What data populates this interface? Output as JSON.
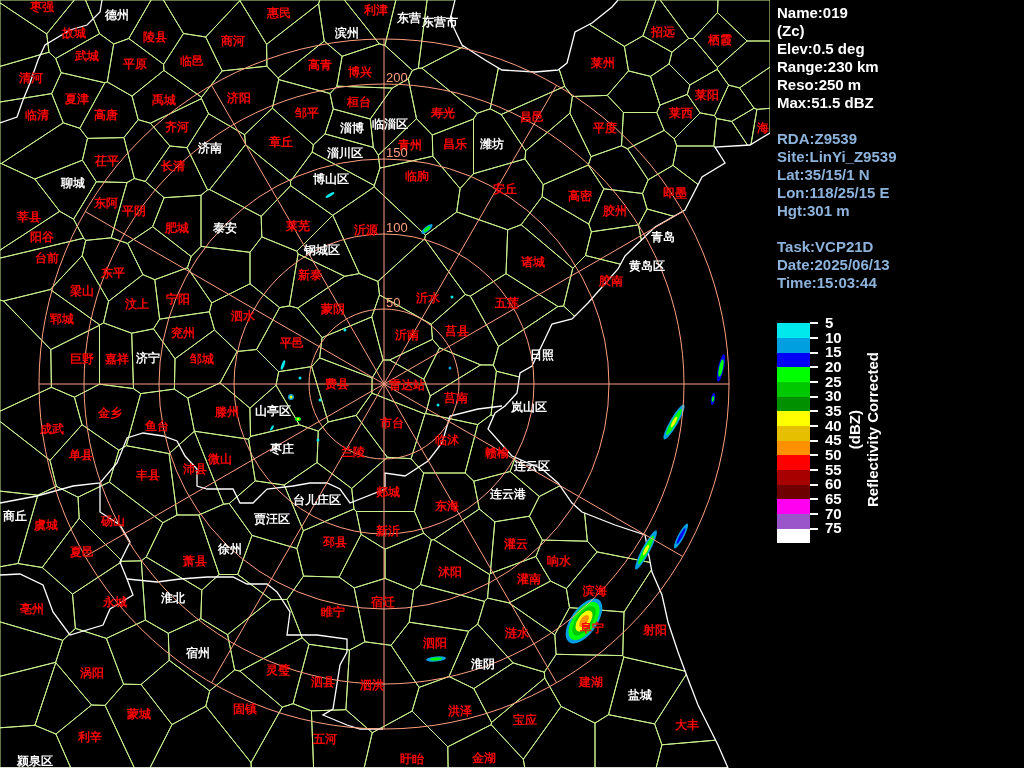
{
  "radar_map": {
    "range_rings": [
      {
        "label": "200"
      },
      {
        "label": "150"
      },
      {
        "label": "100"
      },
      {
        "label": "50"
      }
    ],
    "places": [
      {
        "name": "枣强",
        "color": "#ff0000"
      },
      {
        "name": "德州",
        "color": "#ffffff"
      },
      {
        "name": "惠民",
        "color": "#ff0000"
      },
      {
        "name": "利津",
        "color": "#ff0000"
      },
      {
        "name": "东营",
        "color": "#ffffff"
      },
      {
        "name": "东营市",
        "color": "#ffffff"
      },
      {
        "name": "故城",
        "color": "#ff0000"
      },
      {
        "name": "陵县",
        "color": "#ff0000"
      },
      {
        "name": "商河",
        "color": "#ff0000"
      },
      {
        "name": "滨州",
        "color": "#ffffff"
      },
      {
        "name": "招远",
        "color": "#ff0000"
      },
      {
        "name": "栖霞",
        "color": "#ff0000"
      },
      {
        "name": "武城",
        "color": "#ff0000"
      },
      {
        "name": "平原",
        "color": "#ff0000"
      },
      {
        "name": "临邑",
        "color": "#ff0000"
      },
      {
        "name": "高青",
        "color": "#ff0000"
      },
      {
        "name": "博兴",
        "color": "#ff0000"
      },
      {
        "name": "莱州",
        "color": "#ff0000"
      },
      {
        "name": "清河",
        "color": "#ff0000"
      },
      {
        "name": "夏津",
        "color": "#ff0000"
      },
      {
        "name": "禹城",
        "color": "#ff0000"
      },
      {
        "name": "济阳",
        "color": "#ff0000"
      },
      {
        "name": "桓台",
        "color": "#ff0000"
      },
      {
        "name": "莱阳",
        "color": "#ff0000"
      },
      {
        "name": "临清",
        "color": "#ff0000"
      },
      {
        "name": "高唐",
        "color": "#ff0000"
      },
      {
        "name": "齐河",
        "color": "#ff0000"
      },
      {
        "name": "邹平",
        "color": "#ff0000"
      },
      {
        "name": "淄博",
        "color": "#ffffff"
      },
      {
        "name": "临淄区",
        "color": "#ffffff"
      },
      {
        "name": "寿光",
        "color": "#ff0000"
      },
      {
        "name": "昌邑",
        "color": "#ff0000"
      },
      {
        "name": "平度",
        "color": "#ff0000"
      },
      {
        "name": "莱西",
        "color": "#ff0000"
      },
      {
        "name": "海",
        "color": "#ff0000"
      },
      {
        "name": "济南",
        "color": "#ffffff"
      },
      {
        "name": "章丘",
        "color": "#ff0000"
      },
      {
        "name": "淄川区",
        "color": "#ffffff"
      },
      {
        "name": "青州",
        "color": "#ff0000"
      },
      {
        "name": "昌乐",
        "color": "#ff0000"
      },
      {
        "name": "潍坊",
        "color": "#ffffff"
      },
      {
        "name": "聊城",
        "color": "#ffffff"
      },
      {
        "name": "茌平",
        "color": "#ff0000"
      },
      {
        "name": "长清",
        "color": "#ff0000"
      },
      {
        "name": "博山区",
        "color": "#ffffff"
      },
      {
        "name": "临朐",
        "color": "#ff0000"
      },
      {
        "name": "安丘",
        "color": "#ff0000"
      },
      {
        "name": "高密",
        "color": "#ff0000"
      },
      {
        "name": "即墨",
        "color": "#ff0000"
      },
      {
        "name": "莘县",
        "color": "#ff0000"
      },
      {
        "name": "东阿",
        "color": "#ff0000"
      },
      {
        "name": "平阴",
        "color": "#ff0000"
      },
      {
        "name": "胶州",
        "color": "#ff0000"
      },
      {
        "name": "阳谷",
        "color": "#ff0000"
      },
      {
        "name": "肥城",
        "color": "#ff0000"
      },
      {
        "name": "泰安",
        "color": "#ffffff"
      },
      {
        "name": "莱芜",
        "color": "#ff0000"
      },
      {
        "name": "沂源",
        "color": "#ff0000"
      },
      {
        "name": "青岛",
        "color": "#ffffff"
      },
      {
        "name": "台前",
        "color": "#ff0000"
      },
      {
        "name": "东平",
        "color": "#ff0000"
      },
      {
        "name": "新泰",
        "color": "#ff0000"
      },
      {
        "name": "钢城区",
        "color": "#ffffff"
      },
      {
        "name": "诸城",
        "color": "#ff0000"
      },
      {
        "name": "胶南",
        "color": "#ff0000"
      },
      {
        "name": "黄岛区",
        "color": "#ffffff"
      },
      {
        "name": "郓城",
        "color": "#ff0000"
      },
      {
        "name": "梁山",
        "color": "#ff0000"
      },
      {
        "name": "汶上",
        "color": "#ff0000"
      },
      {
        "name": "宁阳",
        "color": "#ff0000"
      },
      {
        "name": "泗水",
        "color": "#ff0000"
      },
      {
        "name": "蒙阴",
        "color": "#ff0000"
      },
      {
        "name": "沂水",
        "color": "#ff0000"
      },
      {
        "name": "五莲",
        "color": "#ff0000"
      },
      {
        "name": "兖州",
        "color": "#ff0000"
      },
      {
        "name": "平邑",
        "color": "#ff0000"
      },
      {
        "name": "沂南",
        "color": "#ff0000"
      },
      {
        "name": "莒县",
        "color": "#ff0000"
      },
      {
        "name": "巨野",
        "color": "#ff0000"
      },
      {
        "name": "嘉祥",
        "color": "#ff0000"
      },
      {
        "name": "济宁",
        "color": "#ffffff"
      },
      {
        "name": "邹城",
        "color": "#ff0000"
      },
      {
        "name": "日照",
        "color": "#ffffff"
      },
      {
        "name": "费县",
        "color": "#ff0000"
      },
      {
        "name": "雷达站",
        "color": "#ff0000"
      },
      {
        "name": "金乡",
        "color": "#ff0000"
      },
      {
        "name": "滕州",
        "color": "#ff0000"
      },
      {
        "name": "山亭区",
        "color": "#ffffff"
      },
      {
        "name": "莒南",
        "color": "#ff0000"
      },
      {
        "name": "岚山区",
        "color": "#ffffff"
      },
      {
        "name": "成武",
        "color": "#ff0000"
      },
      {
        "name": "鱼台",
        "color": "#ff0000"
      },
      {
        "name": "市台",
        "color": "#ff0000"
      },
      {
        "name": "临沭",
        "color": "#ff0000"
      },
      {
        "name": "单县",
        "color": "#ff0000"
      },
      {
        "name": "丰县",
        "color": "#ff0000"
      },
      {
        "name": "沛县",
        "color": "#ff0000"
      },
      {
        "name": "微山",
        "color": "#ff0000"
      },
      {
        "name": "枣庄",
        "color": "#ffffff"
      },
      {
        "name": "兰陵",
        "color": "#ff0000"
      },
      {
        "name": "赣榆",
        "color": "#ff0000"
      },
      {
        "name": "连云区",
        "color": "#ffffff"
      },
      {
        "name": "台儿庄区",
        "color": "#ffffff"
      },
      {
        "name": "郯城",
        "color": "#ff0000"
      },
      {
        "name": "东海",
        "color": "#ff0000"
      },
      {
        "name": "连云港",
        "color": "#ffffff"
      },
      {
        "name": "商丘",
        "color": "#ffffff"
      },
      {
        "name": "虞城",
        "color": "#ff0000"
      },
      {
        "name": "砀山",
        "color": "#ff0000"
      },
      {
        "name": "贾汪区",
        "color": "#ffffff"
      },
      {
        "name": "新沂",
        "color": "#ff0000"
      },
      {
        "name": "夏邑",
        "color": "#ff0000"
      },
      {
        "name": "萧县",
        "color": "#ff0000"
      },
      {
        "name": "徐州",
        "color": "#ffffff"
      },
      {
        "name": "邳县",
        "color": "#ff0000"
      },
      {
        "name": "沭阳",
        "color": "#ff0000"
      },
      {
        "name": "灌云",
        "color": "#ff0000"
      },
      {
        "name": "灌南",
        "color": "#ff0000"
      },
      {
        "name": "响水",
        "color": "#ff0000"
      },
      {
        "name": "亳州",
        "color": "#ff0000"
      },
      {
        "name": "永城",
        "color": "#ff0000"
      },
      {
        "name": "淮北",
        "color": "#ffffff"
      },
      {
        "name": "睢宁",
        "color": "#ff0000"
      },
      {
        "name": "宿迁",
        "color": "#ff0000"
      },
      {
        "name": "滨海",
        "color": "#ff0000"
      },
      {
        "name": "泗阳",
        "color": "#ff0000"
      },
      {
        "name": "涟水",
        "color": "#ff0000"
      },
      {
        "name": "阜宁",
        "color": "#ff0000"
      },
      {
        "name": "射阳",
        "color": "#ff0000"
      },
      {
        "name": "涡阳",
        "color": "#ff0000"
      },
      {
        "name": "宿州",
        "color": "#ffffff"
      },
      {
        "name": "灵璧",
        "color": "#ff0000"
      },
      {
        "name": "泗县",
        "color": "#ff0000"
      },
      {
        "name": "泗洪",
        "color": "#ff0000"
      },
      {
        "name": "淮阴",
        "color": "#ffffff"
      },
      {
        "name": "建湖",
        "color": "#ff0000"
      },
      {
        "name": "盐城",
        "color": "#ffffff"
      },
      {
        "name": "利辛",
        "color": "#ff0000"
      },
      {
        "name": "蒙城",
        "color": "#ff0000"
      },
      {
        "name": "固镇",
        "color": "#ff0000"
      },
      {
        "name": "五河",
        "color": "#ff0000"
      },
      {
        "name": "洪泽",
        "color": "#ff0000"
      },
      {
        "name": "宝应",
        "color": "#ff0000"
      },
      {
        "name": "大丰",
        "color": "#ff0000"
      },
      {
        "name": "颍泉区",
        "color": "#ffffff"
      },
      {
        "name": "盱眙",
        "color": "#ff0000"
      },
      {
        "name": "金湖",
        "color": "#ff0000"
      }
    ]
  },
  "info": {
    "product": [
      "Name:019",
      "(Zc)",
      "Elev:0.5 deg",
      "Range:230 km",
      "Reso:250 m",
      "Max:51.5 dBZ"
    ],
    "site": [
      "RDA:Z9539",
      "Site:LinYi_Z9539",
      "Lat:35/15/1 N",
      "Lon:118/25/15 E",
      "Hgt:301 m"
    ],
    "task": [
      "Task:VCP21D",
      "Date:2025/06/13",
      "Time:15:03:44"
    ]
  },
  "legend": {
    "unit": "(dBZ)",
    "title": "Reflectivity Corrected",
    "levels": [
      {
        "label": "5",
        "color": "#00e8ec"
      },
      {
        "label": "10",
        "color": "#00a0e0"
      },
      {
        "label": "15",
        "color": "#0000f6"
      },
      {
        "label": "20",
        "color": "#00ff00"
      },
      {
        "label": "25",
        "color": "#00c800"
      },
      {
        "label": "30",
        "color": "#009000"
      },
      {
        "label": "35",
        "color": "#ffff00"
      },
      {
        "label": "40",
        "color": "#e6c000"
      },
      {
        "label": "45",
        "color": "#ff9000"
      },
      {
        "label": "50",
        "color": "#ff0000"
      },
      {
        "label": "55",
        "color": "#a80000"
      },
      {
        "label": "60",
        "color": "#6e0000"
      },
      {
        "label": "65",
        "color": "#ff00f0"
      },
      {
        "label": "70",
        "color": "#9955c9"
      },
      {
        "label": "75",
        "color": "#ffffff"
      }
    ]
  }
}
